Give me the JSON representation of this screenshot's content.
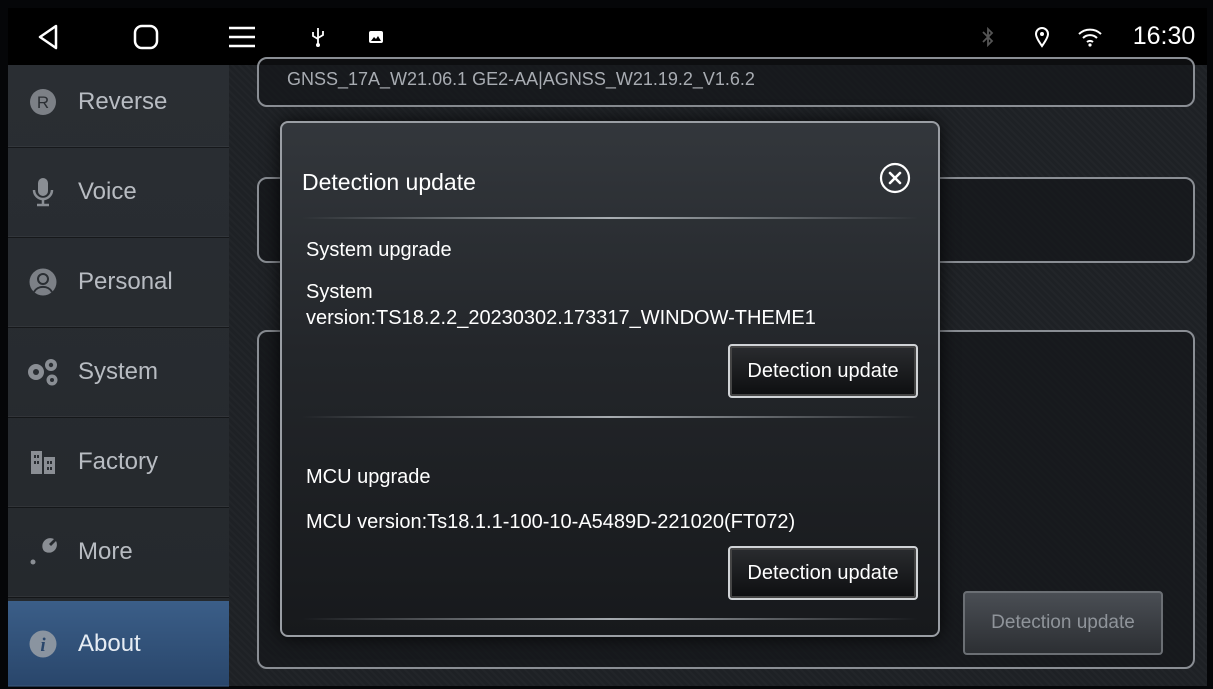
{
  "status_bar": {
    "time": "16:30",
    "icons": [
      "back-icon",
      "home-icon",
      "menu-icon",
      "usb-icon",
      "image-icon",
      "bluetooth-icon",
      "location-icon",
      "wifi-icon"
    ]
  },
  "sidebar": {
    "items": [
      {
        "label": "Reverse",
        "icon": "reverse-icon"
      },
      {
        "label": "Voice",
        "icon": "microphone-icon"
      },
      {
        "label": "Personal",
        "icon": "person-icon"
      },
      {
        "label": "System",
        "icon": "gears-icon"
      },
      {
        "label": "Factory",
        "icon": "factory-icon"
      },
      {
        "label": "More",
        "icon": "wrench-icon"
      },
      {
        "label": "About",
        "icon": "info-icon"
      }
    ],
    "active": "About"
  },
  "background": {
    "gnss_version": "GNSS_17A_W21.06.1 GE2-AA|AGNSS_W21.19.2_V1.6.2",
    "detection_button_label": "Detection update"
  },
  "dialog": {
    "title": "Detection update",
    "system": {
      "heading": "System upgrade",
      "version_label": "System",
      "version_value": "version:TS18.2.2_20230302.173317_WINDOW-THEME1",
      "button_label": "Detection update"
    },
    "mcu": {
      "heading": "MCU upgrade",
      "version_text": "MCU version:Ts18.1.1-100-10-A5489D-221020(FT072)",
      "button_label": "Detection update"
    }
  }
}
